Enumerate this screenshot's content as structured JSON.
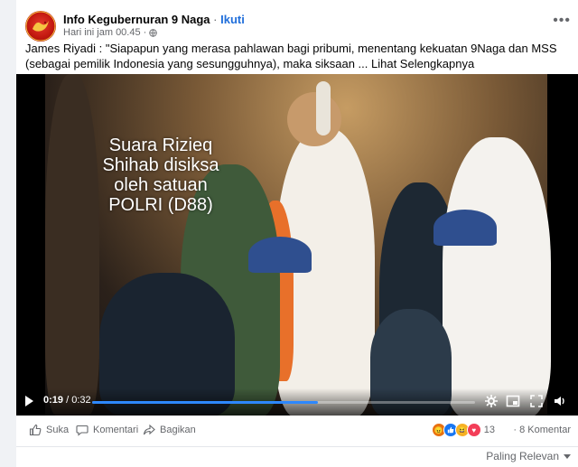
{
  "post": {
    "page_name": "Info Kegubernuran 9 Naga",
    "separator": "·",
    "follow_label": "Ikuti",
    "timestamp": "Hari ini jam 00.45",
    "meta_separator": "·",
    "privacy_icon": "globe-icon",
    "more_icon": "more-options-icon",
    "text": "James Riyadi : \"Siapapun yang merasa pahlawan bagi pribumi, menentang kekuatan 9Naga dan MSS (sebagai pemilik Indonesia yang sesungguhnya), maka siksaan ... Lihat Selengkapnya"
  },
  "video": {
    "overlay_text": "Suara Rizieq Shihab disiksa oleh satuan POLRI (D88)",
    "current_time": "0:19",
    "total_time": "/ 0:32",
    "progress": 0.59,
    "controls": [
      "play-icon",
      "settings-icon",
      "pip-icon",
      "fullscreen-icon",
      "volume-icon"
    ]
  },
  "actions": {
    "like_label": "Suka",
    "comment_label": "Komentari",
    "share_label": "Bagikan",
    "reaction_count": "13",
    "comments_count": "8 Komentar",
    "reactions": [
      "angry",
      "like",
      "haha",
      "love"
    ]
  },
  "comments": {
    "sort_label": "Paling Relevan"
  },
  "colors": {
    "link": "#216fdb",
    "progress": "#2d88ff",
    "muted": "#65676b"
  }
}
